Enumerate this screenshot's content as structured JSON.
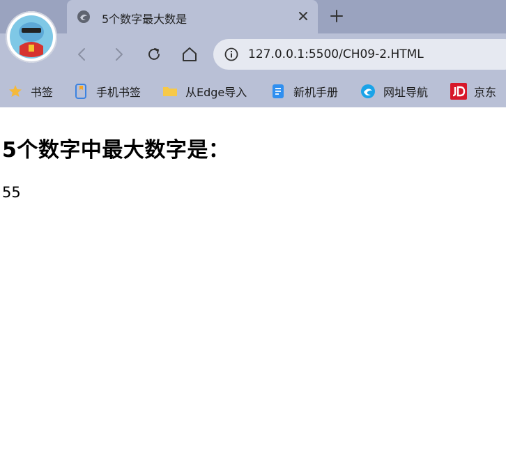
{
  "browser": {
    "tab": {
      "title": "5个数字最大数是",
      "favicon": "edge-page-icon"
    },
    "address": {
      "url": "127.0.0.1:5500/CH09-2.HTML"
    },
    "bookmarks": [
      {
        "label": "书签",
        "icon": "star-icon"
      },
      {
        "label": "手机书签",
        "icon": "phone-bookmark-icon"
      },
      {
        "label": "从Edge导入",
        "icon": "folder-icon"
      },
      {
        "label": "新机手册",
        "icon": "document-icon"
      },
      {
        "label": "网址导航",
        "icon": "edge-icon"
      },
      {
        "label": "京东",
        "icon": "jd-icon"
      }
    ],
    "colors": {
      "tabstrip": "#9aa3bf",
      "toolbar": "#b9c0d6",
      "address_bar": "#e6e9f1"
    }
  },
  "page": {
    "heading": "5个数字中最大数字是：",
    "result": "55"
  }
}
